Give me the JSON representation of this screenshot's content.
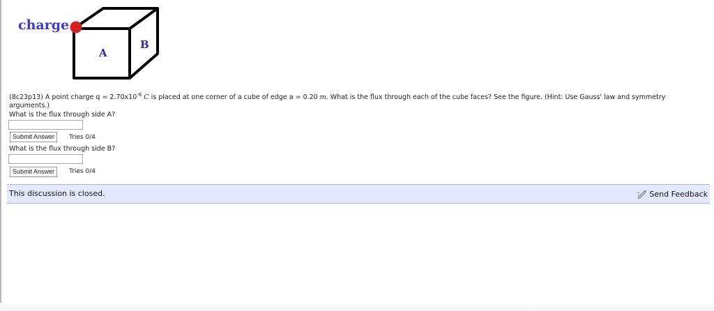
{
  "figure": {
    "charge_label": "charge",
    "face_a_label": "A",
    "face_b_label": "B",
    "charge_color": "#d32020"
  },
  "problem": {
    "text_before_charge": "(8c23p13) A point charge q = 2.70x10",
    "charge_exponent": "-6",
    "charge_unit": "C",
    "text_middle": "is placed at one corner of a cube of edge a = 0.20",
    "edge_unit": "m",
    "text_after": ". What is the flux through each of the cube faces? See the figure. (Hint: Use Gauss' law and symmetry arguments.)"
  },
  "questions": [
    {
      "prompt": "What is the flux through side A?",
      "input_value": "",
      "submit_label": "Submit Answer",
      "tries": "Tries 0/4"
    },
    {
      "prompt": "What is the flux through side B?",
      "input_value": "",
      "submit_label": "Submit Answer",
      "tries": "Tries 0/4"
    }
  ],
  "discussion": {
    "status": "This discussion is closed.",
    "feedback_label": "Send Feedback",
    "feedback_icon": "pencil-icon"
  },
  "colors": {
    "accent_text": "#3c3cc8",
    "discussion_bg": "#e4e8fc",
    "discussion_border": "#a6b6ea"
  }
}
